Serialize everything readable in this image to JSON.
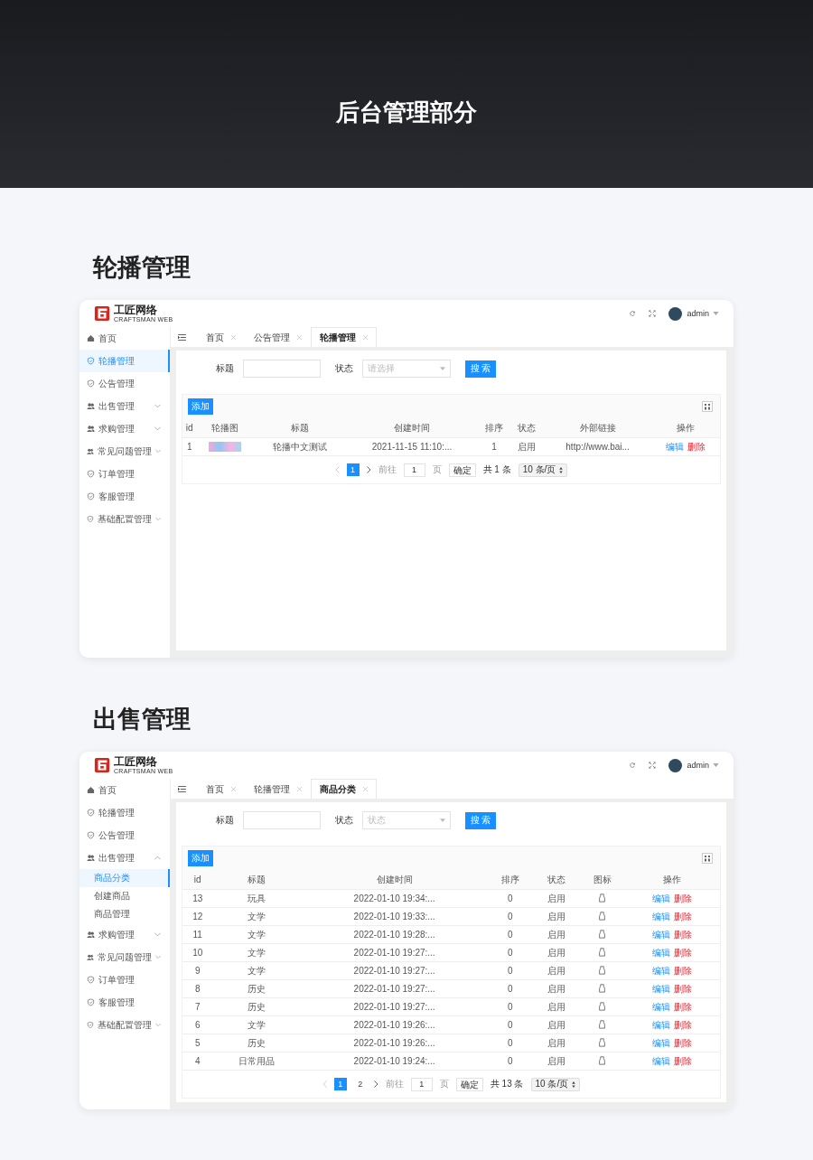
{
  "banner": {
    "title": "后台管理部分"
  },
  "sections": [
    {
      "heading": "轮播管理",
      "screen": {
        "logo": {
          "name": "工匠网络",
          "tagline": "CRAFTSMAN WEB"
        },
        "user": "admin",
        "sidebar": [
          {
            "label": "首页",
            "kind": "home",
            "selected": false
          },
          {
            "label": "轮播管理",
            "kind": "shield",
            "selected": true
          },
          {
            "label": "公告管理",
            "kind": "shield",
            "selected": false
          },
          {
            "label": "出售管理",
            "kind": "users",
            "selected": false,
            "expanded": false
          },
          {
            "label": "求购管理",
            "kind": "users",
            "selected": false,
            "expanded": false
          },
          {
            "label": "常见问题管理",
            "kind": "users",
            "selected": false,
            "expanded": false
          },
          {
            "label": "订单管理",
            "kind": "shield",
            "selected": false
          },
          {
            "label": "客服管理",
            "kind": "shield",
            "selected": false
          },
          {
            "label": "基础配置管理",
            "kind": "shield",
            "selected": false,
            "expanded": false
          }
        ],
        "tabs": [
          {
            "label": "首页",
            "selected": false
          },
          {
            "label": "公告管理",
            "selected": false
          },
          {
            "label": "轮播管理",
            "selected": true
          }
        ],
        "filters": [
          {
            "label": "标题",
            "kind": "input"
          },
          {
            "label": "状态",
            "kind": "select",
            "placeholder": "请选择"
          }
        ],
        "search_button": "搜 索",
        "add_button": "添加",
        "table": {
          "columns": [
            {
              "label": "id",
              "kind": "text"
            },
            {
              "label": "轮播图",
              "kind": "image"
            },
            {
              "label": "标题",
              "kind": "text"
            },
            {
              "label": "创建时间",
              "kind": "text"
            },
            {
              "label": "排序",
              "kind": "text"
            },
            {
              "label": "状态",
              "kind": "text"
            },
            {
              "label": "外部链接",
              "kind": "text"
            },
            {
              "label": "操作",
              "kind": "actions"
            }
          ],
          "rows": [
            {
              "cells": [
                "1",
                "",
                "轮播中文测试",
                "2021-11-15 11:10:...",
                "1",
                "启用",
                "http://www.bai..."
              ],
              "actions": [
                {
                  "label": "编辑",
                  "kind": "edit"
                },
                {
                  "label": "删除",
                  "kind": "delete"
                }
              ]
            }
          ]
        },
        "pagination": {
          "pages": [
            {
              "label": "1",
              "selected": true
            }
          ],
          "goto_label": "前往",
          "goto_value": "1",
          "page_unit": "页",
          "confirm": "确定",
          "total": "共 1 条",
          "page_size": "10 条/页"
        }
      }
    },
    {
      "heading": "出售管理",
      "screen": {
        "logo": {
          "name": "工匠网络",
          "tagline": "CRAFTSMAN WEB"
        },
        "user": "admin",
        "sidebar": [
          {
            "label": "首页",
            "kind": "home",
            "selected": false
          },
          {
            "label": "轮播管理",
            "kind": "shield",
            "selected": false
          },
          {
            "label": "公告管理",
            "kind": "shield",
            "selected": false
          },
          {
            "label": "出售管理",
            "kind": "users",
            "selected": false,
            "expanded": true,
            "children": [
              {
                "label": "商品分类",
                "selected": true
              },
              {
                "label": "创建商品",
                "selected": false
              },
              {
                "label": "商品管理",
                "selected": false
              }
            ]
          },
          {
            "label": "求购管理",
            "kind": "users",
            "selected": false,
            "expanded": false
          },
          {
            "label": "常见问题管理",
            "kind": "users",
            "selected": false,
            "expanded": false
          },
          {
            "label": "订单管理",
            "kind": "shield",
            "selected": false
          },
          {
            "label": "客服管理",
            "kind": "shield",
            "selected": false
          },
          {
            "label": "基础配置管理",
            "kind": "shield",
            "selected": false,
            "expanded": false
          }
        ],
        "tabs": [
          {
            "label": "首页",
            "selected": false
          },
          {
            "label": "轮播管理",
            "selected": false
          },
          {
            "label": "商品分类",
            "selected": true
          }
        ],
        "filters": [
          {
            "label": "标题",
            "kind": "input"
          },
          {
            "label": "状态",
            "kind": "select",
            "placeholder": "状态"
          }
        ],
        "search_button": "搜 索",
        "add_button": "添加",
        "table": {
          "columns": [
            {
              "label": "id",
              "kind": "text"
            },
            {
              "label": "标题",
              "kind": "text"
            },
            {
              "label": "创建时间",
              "kind": "text"
            },
            {
              "label": "排序",
              "kind": "text"
            },
            {
              "label": "状态",
              "kind": "text"
            },
            {
              "label": "图标",
              "kind": "icon"
            },
            {
              "label": "操作",
              "kind": "actions"
            }
          ],
          "rows": [
            {
              "cells": [
                "13",
                "玩具",
                "2022-01-10 19:34:...",
                "0",
                "启用",
                ""
              ],
              "actions": [
                {
                  "label": "编辑",
                  "kind": "edit"
                },
                {
                  "label": "删除",
                  "kind": "delete"
                }
              ]
            },
            {
              "cells": [
                "12",
                "文学",
                "2022-01-10 19:33:...",
                "0",
                "启用",
                ""
              ],
              "actions": [
                {
                  "label": "编辑",
                  "kind": "edit"
                },
                {
                  "label": "删除",
                  "kind": "delete"
                }
              ]
            },
            {
              "cells": [
                "11",
                "文学",
                "2022-01-10 19:28:...",
                "0",
                "启用",
                ""
              ],
              "actions": [
                {
                  "label": "编辑",
                  "kind": "edit"
                },
                {
                  "label": "删除",
                  "kind": "delete"
                }
              ]
            },
            {
              "cells": [
                "10",
                "文学",
                "2022-01-10 19:27:...",
                "0",
                "启用",
                ""
              ],
              "actions": [
                {
                  "label": "编辑",
                  "kind": "edit"
                },
                {
                  "label": "删除",
                  "kind": "delete"
                }
              ]
            },
            {
              "cells": [
                "9",
                "文学",
                "2022-01-10 19:27:...",
                "0",
                "启用",
                ""
              ],
              "actions": [
                {
                  "label": "编辑",
                  "kind": "edit"
                },
                {
                  "label": "删除",
                  "kind": "delete"
                }
              ]
            },
            {
              "cells": [
                "8",
                "历史",
                "2022-01-10 19:27:...",
                "0",
                "启用",
                ""
              ],
              "actions": [
                {
                  "label": "编辑",
                  "kind": "edit"
                },
                {
                  "label": "删除",
                  "kind": "delete"
                }
              ]
            },
            {
              "cells": [
                "7",
                "历史",
                "2022-01-10 19:27:...",
                "0",
                "启用",
                ""
              ],
              "actions": [
                {
                  "label": "编辑",
                  "kind": "edit"
                },
                {
                  "label": "删除",
                  "kind": "delete"
                }
              ]
            },
            {
              "cells": [
                "6",
                "文学",
                "2022-01-10 19:26:...",
                "0",
                "启用",
                ""
              ],
              "actions": [
                {
                  "label": "编辑",
                  "kind": "edit"
                },
                {
                  "label": "删除",
                  "kind": "delete"
                }
              ]
            },
            {
              "cells": [
                "5",
                "历史",
                "2022-01-10 19:26:...",
                "0",
                "启用",
                ""
              ],
              "actions": [
                {
                  "label": "编辑",
                  "kind": "edit"
                },
                {
                  "label": "删除",
                  "kind": "delete"
                }
              ]
            },
            {
              "cells": [
                "4",
                "日常用品",
                "2022-01-10 19:24:...",
                "0",
                "启用",
                ""
              ],
              "actions": [
                {
                  "label": "编辑",
                  "kind": "edit"
                },
                {
                  "label": "删除",
                  "kind": "delete"
                }
              ]
            }
          ]
        },
        "pagination": {
          "pages": [
            {
              "label": "1",
              "selected": true
            },
            {
              "label": "2",
              "selected": false
            }
          ],
          "goto_label": "前往",
          "goto_value": "1",
          "page_unit": "页",
          "confirm": "确定",
          "total": "共 13 条",
          "page_size": "10 条/页"
        }
      }
    }
  ]
}
